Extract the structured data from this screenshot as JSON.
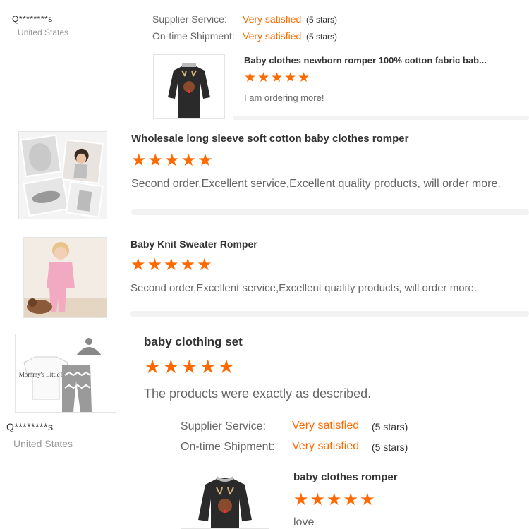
{
  "review1": {
    "username": "Q********s",
    "country": "United States",
    "supplier_label": "Supplier Service:",
    "supplier_value": "Very satisfied",
    "supplier_stars": "(5 stars)",
    "shipment_label": "On-time Shipment:",
    "shipment_value": "Very satisfied",
    "shipment_stars": "(5 stars)",
    "product_title": "Baby clothes newborn romper 100% cotton fabric bab...",
    "rating_stars": "★★★★★",
    "comment": "I am ordering more!"
  },
  "card2": {
    "product_title": "Wholesale long sleeve soft cotton baby clothes romper",
    "rating_stars": "★★★★★",
    "comment": "Second order,Excellent service,Excellent quality products, will order more."
  },
  "card3": {
    "product_title": "Baby Knit Sweater Romper",
    "rating_stars": "★★★★★",
    "comment": "Second order,Excellent service,Excellent quality products, will order more."
  },
  "card4": {
    "product_title": "baby clothing set",
    "rating_stars": "★★★★★",
    "comment": "The products were exactly as described.",
    "print_text": "Mommy's Little Man"
  },
  "review5": {
    "username": "Q********s",
    "country": "United States",
    "supplier_label": "Supplier Service:",
    "supplier_value": "Very satisfied",
    "supplier_stars": "(5 stars)",
    "shipment_label": "On-time Shipment:",
    "shipment_value": "Very satisfied",
    "shipment_stars": "(5 stars)",
    "product_title": "baby clothes romper",
    "rating_stars": "★★★★★",
    "comment": "love"
  },
  "colors": {
    "accent": "#ff6a00",
    "text": "#333333",
    "muted": "#999999",
    "divider": "#f2f2f2"
  }
}
